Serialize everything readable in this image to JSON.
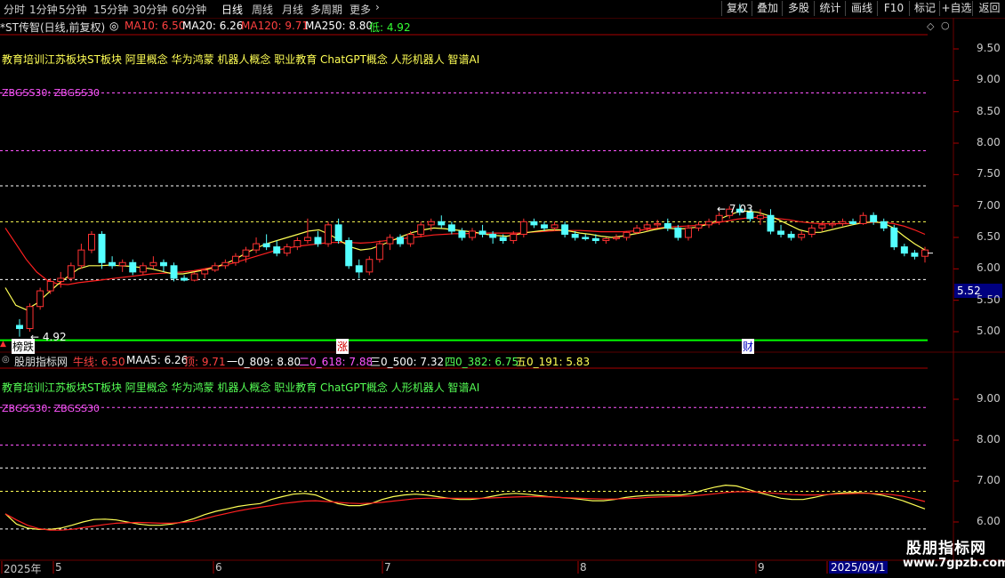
{
  "toolbar": {
    "periods": [
      "分时",
      "1分钟",
      "5分钟",
      "15分钟",
      "30分钟",
      "60分钟",
      "日线",
      "周线",
      "月线",
      "多周期",
      "更多"
    ],
    "active_period": "日线",
    "more_chevron": "chevron-right-icon",
    "buttons": [
      "复权",
      "叠加",
      "多股",
      "统计",
      "画线",
      "F10",
      "标记",
      "+自选",
      "返回"
    ]
  },
  "main_panel": {
    "title": "*ST传智(日线,前复权)",
    "ma10": "MA10: 6.50",
    "ma20": "MA20: 6.26",
    "ma120": "MA120: 9.71",
    "ma250": "MA250: 8.80",
    "low": "低: 4.92",
    "concepts": "教育培训江苏板块ST板块 阿里概念 华为鸿蒙 机器人概念 职业教育 ChatGPT概念 人形机器人 智谱AI",
    "zbg": "ZBGSS30: ZBGSS30",
    "current_price": "5.52",
    "max_label": "7.03",
    "min_label": "4.92",
    "marker_rank": "榜跌",
    "marker_rise": "涨",
    "marker_fin": "财"
  },
  "sub_panel": {
    "title": "股朋指标网",
    "niu": "牛线: 6.50",
    "maa5": "MAA5: 6.26",
    "ding": "顶: 9.71",
    "l1": "一0_809: 8.80",
    "l2": "二0_618: 7.88",
    "l3": "三0_500: 7.32",
    "l4": "四0_382: 6.75",
    "l5": "五0_191: 5.83",
    "concepts": "教育培训江苏板块ST板块 阿里概念 华为鸿蒙 机器人概念 职业教育 ChatGPT概念 人形机器人 智谱AI",
    "zbg": "ZBGSS30: ZBGSS30"
  },
  "x_axis": {
    "labels": [
      "2025年",
      "5",
      "6",
      "7",
      "8",
      "9",
      "2025/09/1"
    ]
  },
  "logo": {
    "name": "股朋指标网",
    "url": "www.7gpzb.com"
  },
  "colors": {
    "up": "#ff3232",
    "down": "#54ffff",
    "ma_fast": "#ffff55",
    "ma_slow": "#ff2020",
    "grid_white": "#ffffff",
    "grid_yellow": "#ffff55",
    "grid_magenta": "#ff55ff",
    "green_line": "#00ff00",
    "red_frame": "#aa0000"
  },
  "chart_data": [
    {
      "type": "candlestick",
      "title": "*ST传智(日线,前复权)",
      "ylim": [
        4.8,
        9.8
      ],
      "y_ticks": [
        5.0,
        5.5,
        6.0,
        6.5,
        7.0,
        7.5,
        8.0,
        8.5,
        9.0,
        9.5
      ],
      "levels": {
        "magenta": [
          8.8,
          7.88
        ],
        "white": [
          7.32,
          5.83
        ],
        "yellow": [
          6.75
        ],
        "green": [
          4.92
        ]
      },
      "ohlc": [
        [
          5.1,
          5.2,
          4.92,
          5.05
        ],
        [
          5.05,
          5.45,
          5.0,
          5.4
        ],
        [
          5.4,
          5.7,
          5.35,
          5.65
        ],
        [
          5.65,
          5.85,
          5.6,
          5.8
        ],
        [
          5.8,
          5.95,
          5.7,
          5.85
        ],
        [
          5.85,
          6.1,
          5.8,
          6.05
        ],
        [
          6.05,
          6.4,
          6.0,
          6.3
        ],
        [
          6.3,
          6.6,
          6.25,
          6.55
        ],
        [
          6.55,
          6.6,
          6.0,
          6.1
        ],
        [
          6.1,
          6.2,
          6.0,
          6.05
        ],
        [
          6.05,
          6.15,
          5.95,
          6.1
        ],
        [
          6.1,
          6.15,
          5.9,
          5.95
        ],
        [
          5.95,
          6.1,
          5.9,
          6.05
        ],
        [
          6.05,
          6.2,
          6.0,
          6.1
        ],
        [
          6.1,
          6.15,
          5.95,
          6.05
        ],
        [
          6.05,
          6.1,
          5.8,
          5.85
        ],
        [
          5.85,
          5.9,
          5.8,
          5.82
        ],
        [
          5.82,
          5.95,
          5.8,
          5.92
        ],
        [
          5.92,
          6.0,
          5.85,
          5.98
        ],
        [
          5.98,
          6.1,
          5.95,
          6.05
        ],
        [
          6.05,
          6.15,
          6.0,
          6.1
        ],
        [
          6.1,
          6.25,
          6.05,
          6.2
        ],
        [
          6.2,
          6.35,
          6.1,
          6.3
        ],
        [
          6.3,
          6.5,
          6.25,
          6.4
        ],
        [
          6.4,
          6.55,
          6.3,
          6.35
        ],
        [
          6.35,
          6.45,
          6.2,
          6.25
        ],
        [
          6.25,
          6.4,
          6.2,
          6.35
        ],
        [
          6.35,
          6.5,
          6.3,
          6.45
        ],
        [
          6.45,
          6.8,
          6.4,
          6.5
        ],
        [
          6.5,
          6.6,
          6.35,
          6.4
        ],
        [
          6.4,
          6.75,
          6.35,
          6.7
        ],
        [
          6.7,
          6.8,
          6.4,
          6.45
        ],
        [
          6.45,
          6.5,
          6.0,
          6.05
        ],
        [
          6.05,
          6.15,
          5.85,
          5.95
        ],
        [
          5.95,
          6.2,
          5.9,
          6.15
        ],
        [
          6.15,
          6.45,
          6.1,
          6.4
        ],
        [
          6.4,
          6.55,
          6.3,
          6.5
        ],
        [
          6.5,
          6.55,
          6.35,
          6.4
        ],
        [
          6.4,
          6.6,
          6.35,
          6.55
        ],
        [
          6.55,
          6.75,
          6.5,
          6.7
        ],
        [
          6.7,
          6.8,
          6.6,
          6.75
        ],
        [
          6.75,
          6.85,
          6.65,
          6.7
        ],
        [
          6.7,
          6.75,
          6.55,
          6.6
        ],
        [
          6.6,
          6.65,
          6.45,
          6.5
        ],
        [
          6.5,
          6.65,
          6.45,
          6.6
        ],
        [
          6.6,
          6.7,
          6.5,
          6.55
        ],
        [
          6.55,
          6.6,
          6.4,
          6.5
        ],
        [
          6.5,
          6.55,
          6.4,
          6.45
        ],
        [
          6.45,
          6.6,
          6.4,
          6.55
        ],
        [
          6.55,
          6.8,
          6.5,
          6.75
        ],
        [
          6.75,
          6.8,
          6.65,
          6.7
        ],
        [
          6.7,
          6.75,
          6.6,
          6.65
        ],
        [
          6.65,
          6.75,
          6.6,
          6.7
        ],
        [
          6.7,
          6.75,
          6.5,
          6.55
        ],
        [
          6.55,
          6.6,
          6.45,
          6.5
        ],
        [
          6.5,
          6.55,
          6.45,
          6.48
        ],
        [
          6.48,
          6.55,
          6.4,
          6.45
        ],
        [
          6.45,
          6.5,
          6.4,
          6.48
        ],
        [
          6.48,
          6.55,
          6.45,
          6.5
        ],
        [
          6.5,
          6.6,
          6.45,
          6.58
        ],
        [
          6.58,
          6.7,
          6.55,
          6.65
        ],
        [
          6.65,
          6.75,
          6.6,
          6.7
        ],
        [
          6.7,
          6.78,
          6.65,
          6.72
        ],
        [
          6.72,
          6.8,
          6.6,
          6.65
        ],
        [
          6.65,
          6.7,
          6.45,
          6.5
        ],
        [
          6.5,
          6.7,
          6.45,
          6.65
        ],
        [
          6.65,
          6.75,
          6.6,
          6.7
        ],
        [
          6.7,
          6.8,
          6.65,
          6.75
        ],
        [
          6.75,
          6.9,
          6.7,
          6.85
        ],
        [
          6.85,
          7.0,
          6.8,
          6.95
        ],
        [
          6.95,
          7.03,
          6.85,
          6.9
        ],
        [
          6.9,
          6.95,
          6.75,
          6.8
        ],
        [
          6.8,
          6.95,
          6.7,
          6.85
        ],
        [
          6.85,
          6.95,
          6.55,
          6.6
        ],
        [
          6.6,
          6.7,
          6.5,
          6.55
        ],
        [
          6.55,
          6.6,
          6.45,
          6.5
        ],
        [
          6.5,
          6.6,
          6.45,
          6.55
        ],
        [
          6.55,
          6.7,
          6.5,
          6.65
        ],
        [
          6.65,
          6.75,
          6.6,
          6.7
        ],
        [
          6.7,
          6.75,
          6.65,
          6.72
        ],
        [
          6.72,
          6.8,
          6.68,
          6.75
        ],
        [
          6.75,
          6.8,
          6.7,
          6.72
        ],
        [
          6.72,
          6.9,
          6.7,
          6.85
        ],
        [
          6.85,
          6.9,
          6.7,
          6.75
        ],
        [
          6.75,
          6.8,
          6.6,
          6.65
        ],
        [
          6.65,
          6.7,
          6.3,
          6.35
        ],
        [
          6.35,
          6.4,
          6.2,
          6.25
        ],
        [
          6.25,
          6.3,
          6.15,
          6.2
        ],
        [
          6.2,
          6.35,
          6.1,
          6.3
        ]
      ],
      "ma_fast": [
        5.7,
        5.42,
        5.35,
        5.45,
        5.6,
        5.75,
        5.88,
        6.0,
        6.05,
        6.05,
        6.06,
        6.05,
        6.04,
        6.02,
        6.0,
        5.96,
        5.92,
        5.92,
        5.95,
        5.98,
        6.02,
        6.08,
        6.15,
        6.25,
        6.33,
        6.4,
        6.45,
        6.5,
        6.55,
        6.6,
        6.62,
        6.55,
        6.45,
        6.35,
        6.3,
        6.32,
        6.38,
        6.45,
        6.52,
        6.58,
        6.62,
        6.65,
        6.64,
        6.62,
        6.6,
        6.58,
        6.55,
        6.53,
        6.52,
        6.55,
        6.58,
        6.6,
        6.62,
        6.62,
        6.6,
        6.57,
        6.55,
        6.52,
        6.5,
        6.52,
        6.55,
        6.58,
        6.62,
        6.65,
        6.64,
        6.64,
        6.66,
        6.7,
        6.76,
        6.84,
        6.9,
        6.92,
        6.9,
        6.85,
        6.78,
        6.7,
        6.62,
        6.58,
        6.58,
        6.62,
        6.66,
        6.7,
        6.73,
        6.75,
        6.73,
        6.65,
        6.52,
        6.4,
        6.3
      ],
      "ma_slow": [
        6.65,
        6.4,
        6.15,
        5.95,
        5.82,
        5.76,
        5.75,
        5.78,
        5.8,
        5.82,
        5.84,
        5.86,
        5.88,
        5.9,
        5.92,
        5.93,
        5.94,
        5.95,
        5.97,
        6.0,
        6.03,
        6.06,
        6.1,
        6.15,
        6.2,
        6.25,
        6.3,
        6.33,
        6.36,
        6.38,
        6.4,
        6.42,
        6.42,
        6.42,
        6.41,
        6.42,
        6.44,
        6.46,
        6.48,
        6.5,
        6.52,
        6.54,
        6.55,
        6.56,
        6.56,
        6.57,
        6.57,
        6.57,
        6.57,
        6.57,
        6.58,
        6.59,
        6.6,
        6.61,
        6.61,
        6.61,
        6.6,
        6.59,
        6.59,
        6.59,
        6.6,
        6.62,
        6.64,
        6.66,
        6.67,
        6.68,
        6.69,
        6.71,
        6.73,
        6.76,
        6.79,
        6.81,
        6.82,
        6.82,
        6.8,
        6.78,
        6.75,
        6.73,
        6.72,
        6.72,
        6.72,
        6.72,
        6.73,
        6.74,
        6.74,
        6.72,
        6.68,
        6.62,
        6.55
      ]
    },
    {
      "type": "line",
      "title": "股朋指标网",
      "ylim": [
        5.8,
        10.0
      ],
      "y_ticks": [
        6.0,
        7.0,
        8.0,
        9.0
      ],
      "levels": {
        "magenta": [
          8.8,
          7.88
        ],
        "white": [
          7.32,
          5.83
        ],
        "yellow": [
          6.75
        ]
      },
      "series": [
        {
          "name": "牛线",
          "color": "#ffff55",
          "values": [
            6.2,
            5.95,
            5.85,
            5.82,
            5.82,
            5.85,
            5.92,
            6.0,
            6.06,
            6.07,
            6.05,
            6.0,
            5.95,
            5.92,
            5.92,
            5.95,
            6.0,
            6.08,
            6.18,
            6.26,
            6.32,
            6.38,
            6.42,
            6.45,
            6.55,
            6.62,
            6.68,
            6.7,
            6.66,
            6.55,
            6.45,
            6.4,
            6.4,
            6.45,
            6.55,
            6.62,
            6.66,
            6.68,
            6.66,
            6.62,
            6.58,
            6.55,
            6.55,
            6.58,
            6.63,
            6.68,
            6.7,
            6.68,
            6.65,
            6.62,
            6.6,
            6.58,
            6.55,
            6.52,
            6.52,
            6.55,
            6.6,
            6.63,
            6.65,
            6.66,
            6.66,
            6.66,
            6.7,
            6.78,
            6.85,
            6.9,
            6.88,
            6.8,
            6.72,
            6.65,
            6.58,
            6.55,
            6.55,
            6.6,
            6.66,
            6.7,
            6.72,
            6.72,
            6.7,
            6.66,
            6.6,
            6.52,
            6.42,
            6.32
          ]
        },
        {
          "name": "MAA5",
          "color": "#ff2020",
          "values": [
            6.2,
            6.05,
            5.92,
            5.84,
            5.8,
            5.8,
            5.82,
            5.86,
            5.9,
            5.94,
            5.97,
            5.98,
            5.99,
            5.98,
            5.97,
            5.97,
            5.99,
            6.02,
            6.08,
            6.15,
            6.21,
            6.27,
            6.32,
            6.36,
            6.4,
            6.45,
            6.48,
            6.51,
            6.52,
            6.5,
            6.48,
            6.46,
            6.45,
            6.46,
            6.48,
            6.51,
            6.54,
            6.57,
            6.58,
            6.58,
            6.58,
            6.58,
            6.58,
            6.58,
            6.59,
            6.6,
            6.61,
            6.62,
            6.62,
            6.61,
            6.6,
            6.59,
            6.58,
            6.57,
            6.56,
            6.56,
            6.57,
            6.58,
            6.6,
            6.61,
            6.62,
            6.63,
            6.64,
            6.66,
            6.69,
            6.72,
            6.74,
            6.74,
            6.73,
            6.71,
            6.69,
            6.67,
            6.66,
            6.66,
            6.67,
            6.68,
            6.69,
            6.7,
            6.7,
            6.69,
            6.67,
            6.63,
            6.57,
            6.5
          ]
        }
      ]
    }
  ]
}
